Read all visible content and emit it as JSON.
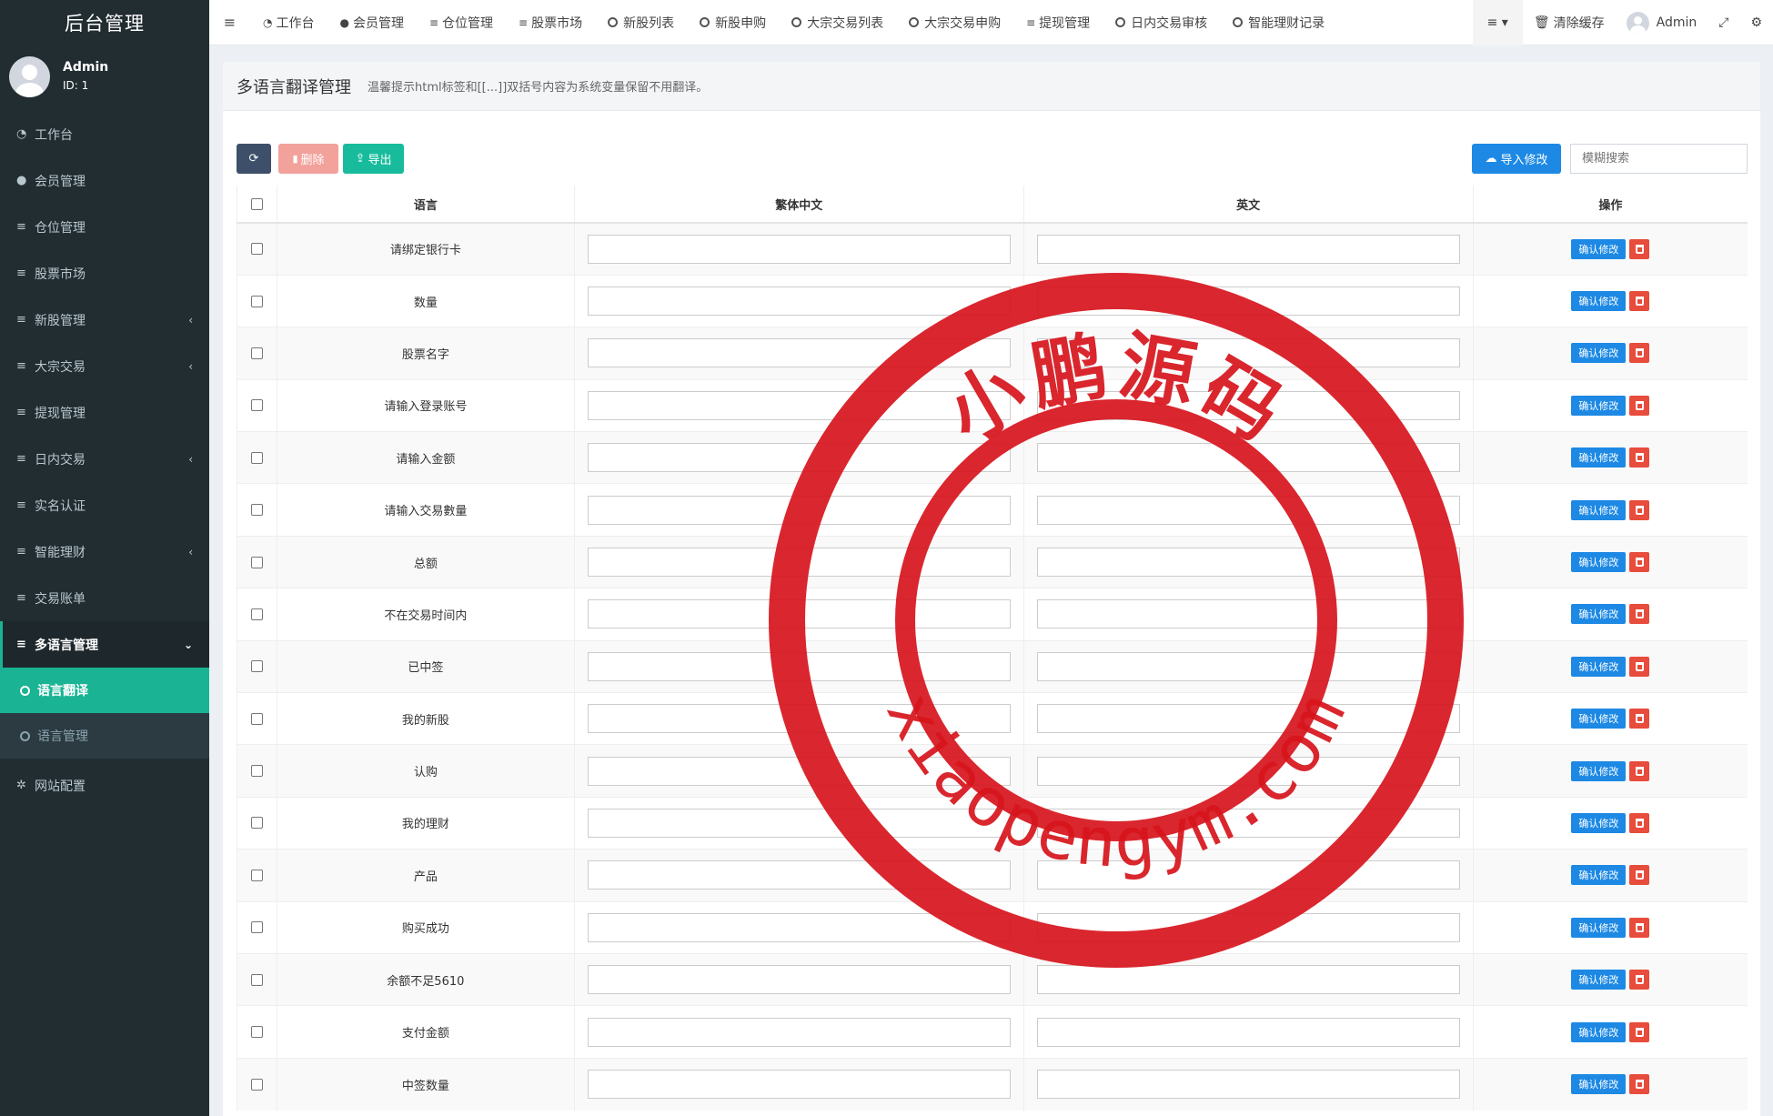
{
  "brand": "后台管理",
  "user": {
    "name": "Admin",
    "id": "ID: 1"
  },
  "sidebar": {
    "items": [
      {
        "label": "工作台"
      },
      {
        "label": "会员管理"
      },
      {
        "label": "仓位管理"
      },
      {
        "label": "股票市场"
      },
      {
        "label": "新股管理"
      },
      {
        "label": "大宗交易"
      },
      {
        "label": "提现管理"
      },
      {
        "label": "日内交易"
      },
      {
        "label": "实名认证"
      },
      {
        "label": "智能理财"
      },
      {
        "label": "交易账单"
      },
      {
        "label": "多语言管理"
      },
      {
        "label": "网站配置"
      }
    ],
    "subitems": [
      {
        "label": "语言翻译"
      },
      {
        "label": "语言管理"
      }
    ]
  },
  "topnav": {
    "tabs": [
      {
        "label": "工作台"
      },
      {
        "label": "会员管理"
      },
      {
        "label": "仓位管理"
      },
      {
        "label": "股票市场"
      },
      {
        "label": "新股列表"
      },
      {
        "label": "新股申购"
      },
      {
        "label": "大宗交易列表"
      },
      {
        "label": "大宗交易申购"
      },
      {
        "label": "提现管理"
      },
      {
        "label": "日内交易审核"
      },
      {
        "label": "智能理财记录"
      }
    ],
    "clear_cache": "清除缓存",
    "admin": "Admin"
  },
  "page": {
    "title": "多语言翻译管理",
    "tip": "温馨提示html标签和[[...]]双括号内容为系统变量保留不用翻译。"
  },
  "toolbar": {
    "delete": "删除",
    "export": "导出",
    "import": "导入修改",
    "search_placeholder": "模糊搜索"
  },
  "table": {
    "headers": {
      "lang": "语言",
      "zh_tw": "繁体中文",
      "en": "英文",
      "ops": "操作"
    },
    "confirm_label": "确认修改",
    "rows": [
      "请绑定银行卡",
      "数量",
      "股票名字",
      "请输入登录账号",
      "请输入金额",
      "请输入交易數量",
      "总额",
      "不在交易时间内",
      "已中签",
      "我的新股",
      "认购",
      "我的理财",
      "产品",
      "购买成功",
      "余额不足5610",
      "支付金额",
      "中签数量"
    ]
  },
  "watermark": {
    "top": "小鹏源码",
    "bottom": "xiaopengym.com",
    "color": "#d7141c"
  }
}
